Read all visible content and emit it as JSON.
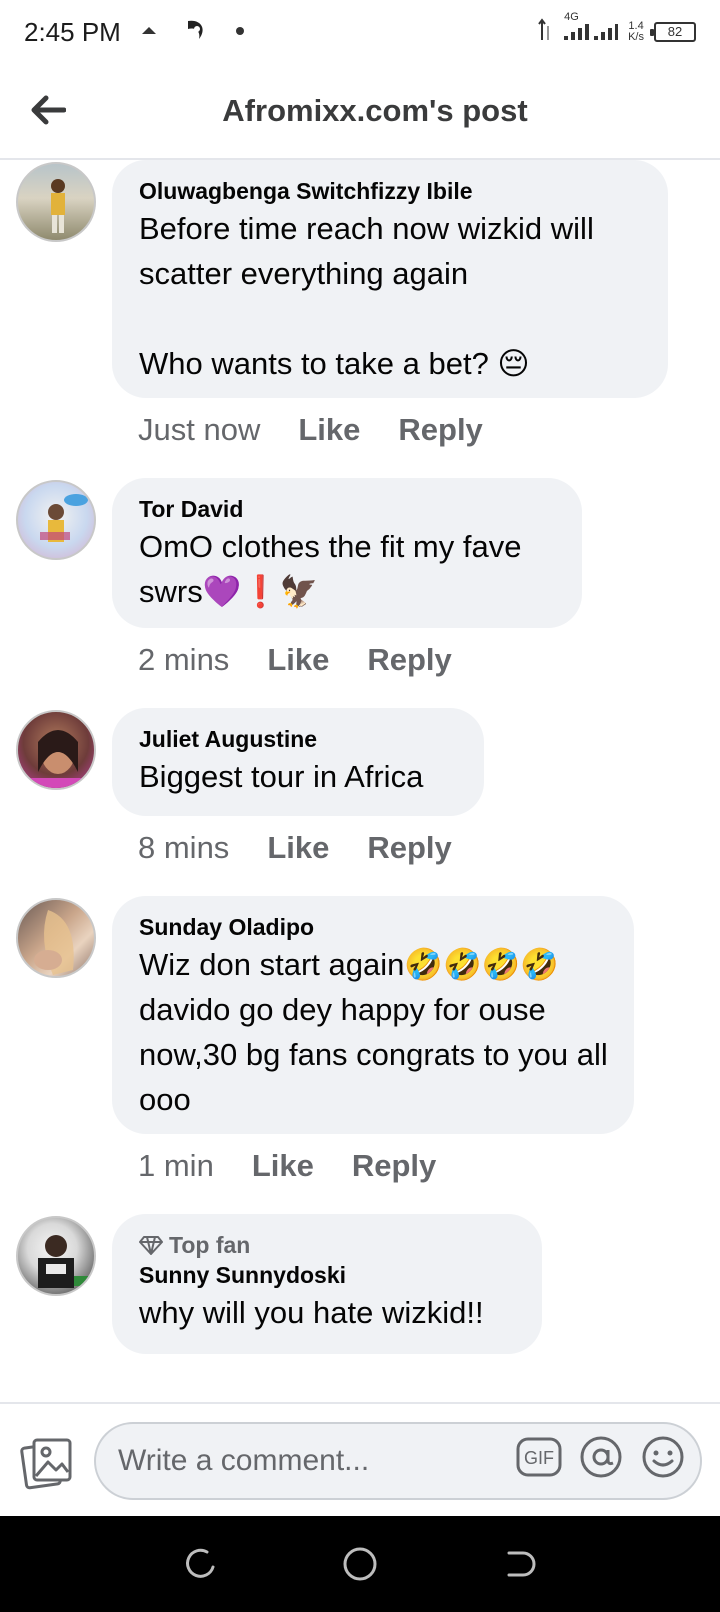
{
  "status_bar": {
    "time": "2:45 PM",
    "network_type": "4G",
    "speed_value": "1.4",
    "speed_unit": "K/s",
    "battery": "82"
  },
  "header": {
    "title": "Afromixx.com's post"
  },
  "comments": [
    {
      "author": "Oluwagbenga Switchfizzy Ibile",
      "text": "Before time reach now wizkid will scatter everything again\n\nWho wants to take a bet? 😔",
      "time": "Just now",
      "like": "Like",
      "reply": "Reply"
    },
    {
      "author": "Tor David",
      "text": "OmO clothes the fit my fave swrs💜❗🦅",
      "time": "2 mins",
      "like": "Like",
      "reply": "Reply"
    },
    {
      "author": "Juliet Augustine",
      "text": "Biggest tour in Africa",
      "time": "8 mins",
      "like": "Like",
      "reply": "Reply"
    },
    {
      "author": "Sunday Oladipo",
      "text": "Wiz don start again🤣🤣🤣🤣davido go dey happy for ouse now,30 bg fans congrats to you all ooo",
      "time": "1 min",
      "like": "Like",
      "reply": "Reply"
    },
    {
      "badge": "Top fan",
      "author": "Sunny Sunnydoski",
      "text": "why will you hate wizkid!!"
    }
  ],
  "composer": {
    "placeholder": "Write a comment..."
  },
  "colors": {
    "bubble": "#f0f2f5",
    "secondary_text": "#65676b",
    "primary_text": "#050505"
  }
}
